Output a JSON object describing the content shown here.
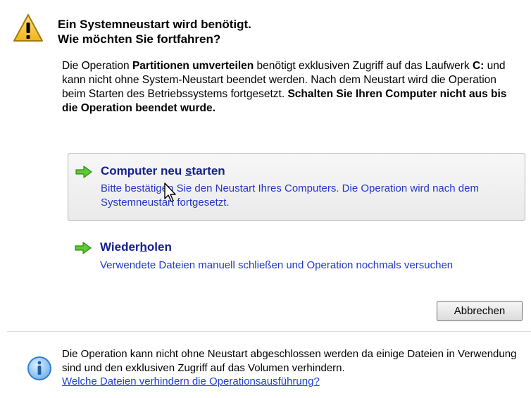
{
  "dialog": {
    "title_line1": "Ein Systemneustart wird benötigt.",
    "title_line2": "Wie möchten Sie fortfahren?",
    "description": {
      "p1": "Die Operation ",
      "op_name": "Partitionen umverteilen",
      "p2": " benötigt exklusiven Zugriff auf das Laufwerk ",
      "drive": "C:",
      "p3": " und kann nicht ohne System-Neustart beendet werden. Nach dem Neustart wird die Operation beim Starten des Betriebssystems fortgesetzt. ",
      "warning": "Schalten Sie Ihren Computer nicht aus bis die Operation beendet wurde."
    },
    "options": [
      {
        "title_pre": "Computer neu ",
        "title_ul": "s",
        "title_post": "tarten",
        "text": "Bitte bestätigen Sie den Neustart Ihres Computers. Die Operation wird nach dem Systemneustart fortgesetzt."
      },
      {
        "title_pre": "Wieder",
        "title_ul": "h",
        "title_post": "olen",
        "text": "Verwendete Dateien manuell schließen und Operation nochmals versuchen"
      }
    ],
    "cancel_label": "Abbrechen",
    "footer_text": "Die Operation kann nicht ohne Neustart abgeschlossen werden da einige Dateien in Verwendung sind und den exklusiven Zugriff auf das Volumen verhindern.",
    "footer_link": "Welche Dateien verhindern die Operationsausführung?"
  },
  "colors": {
    "link_title": "#15208f",
    "link_text": "#2436c9",
    "footer_link": "#1c3fdc",
    "warning_yellow": "#f7c72f",
    "arrow_green": "#4caf2a",
    "info_blue": "#2f7fd0"
  },
  "icons": {
    "warning": "warning-triangle-icon",
    "arrow": "green-arrow-icon",
    "info": "info-icon",
    "cursor": "mouse-pointer-icon"
  }
}
